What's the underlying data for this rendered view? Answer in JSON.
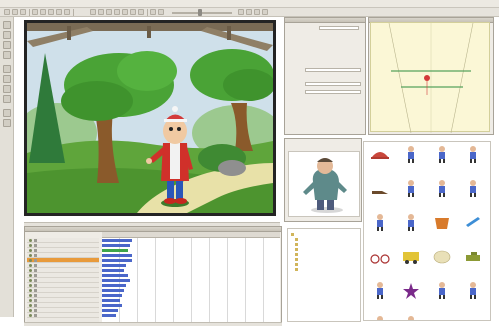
{
  "menubar": {
    "items": [
      "",
      "",
      "",
      "",
      "",
      "",
      ""
    ]
  },
  "stage": {
    "character_name": ""
  },
  "properties": {
    "title": "",
    "rows": [
      "",
      "",
      "",
      "",
      "",
      "",
      "",
      "",
      "",
      "",
      ""
    ]
  },
  "scene": {
    "title": ""
  },
  "timeline": {
    "layers": [
      {
        "label": "",
        "selected": false
      },
      {
        "label": "",
        "selected": false
      },
      {
        "label": "",
        "selected": false
      },
      {
        "label": "",
        "selected": false
      },
      {
        "label": "",
        "selected": true
      },
      {
        "label": "",
        "selected": false
      },
      {
        "label": "",
        "selected": false
      },
      {
        "label": "",
        "selected": false
      },
      {
        "label": "",
        "selected": false
      },
      {
        "label": "",
        "selected": false
      },
      {
        "label": "",
        "selected": false
      },
      {
        "label": "",
        "selected": false
      },
      {
        "label": "",
        "selected": false
      },
      {
        "label": "",
        "selected": false
      },
      {
        "label": "",
        "selected": false
      },
      {
        "label": "",
        "selected": false
      }
    ]
  },
  "library": {
    "tree": [
      "",
      "",
      "",
      "",
      "",
      "",
      "",
      ""
    ],
    "items": [
      {
        "icon": "hat-icon",
        "caption": ""
      },
      {
        "icon": "figure-icon",
        "caption": ""
      },
      {
        "icon": "figure-icon",
        "caption": ""
      },
      {
        "icon": "figure-icon",
        "caption": ""
      },
      {
        "icon": "shoe-icon",
        "caption": ""
      },
      {
        "icon": "figure-icon",
        "caption": ""
      },
      {
        "icon": "figure-icon",
        "caption": ""
      },
      {
        "icon": "figure-icon",
        "caption": ""
      },
      {
        "icon": "figure-icon",
        "caption": ""
      },
      {
        "icon": "figure-icon",
        "caption": ""
      },
      {
        "icon": "pot-icon",
        "caption": ""
      },
      {
        "icon": "brush-icon",
        "caption": ""
      },
      {
        "icon": "bike-icon",
        "caption": ""
      },
      {
        "icon": "bus-icon",
        "caption": ""
      },
      {
        "icon": "plate-icon",
        "caption": ""
      },
      {
        "icon": "tank-icon",
        "caption": ""
      },
      {
        "icon": "figure-icon",
        "caption": ""
      },
      {
        "icon": "star-icon",
        "caption": ""
      },
      {
        "icon": "figure-icon",
        "caption": ""
      },
      {
        "icon": "figure-icon",
        "caption": ""
      },
      {
        "icon": "figure-icon",
        "caption": ""
      },
      {
        "icon": "figure-icon",
        "caption": ""
      }
    ]
  },
  "colors": {
    "selection": "#e89a3b",
    "timeline_keys": "#4b67c9",
    "timeline_green": "#3fa54a",
    "scene_lines": "#56a35d",
    "scene_marker": "#d33a3a"
  }
}
